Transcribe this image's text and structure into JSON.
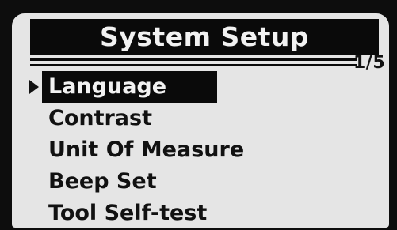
{
  "header": {
    "title": "System Setup",
    "page_indicator": "1/5"
  },
  "menu": {
    "selected_index": 0,
    "items": [
      {
        "label": "Language"
      },
      {
        "label": "Contrast"
      },
      {
        "label": "Unit Of Measure"
      },
      {
        "label": "Beep Set"
      },
      {
        "label": "Tool Self-test"
      }
    ]
  },
  "cursor_icon": "triangle-right-icon",
  "colors": {
    "screen_bg": "#e5e5e5",
    "ink": "#0a0a0a",
    "highlight_text": "#f2f2f2"
  }
}
